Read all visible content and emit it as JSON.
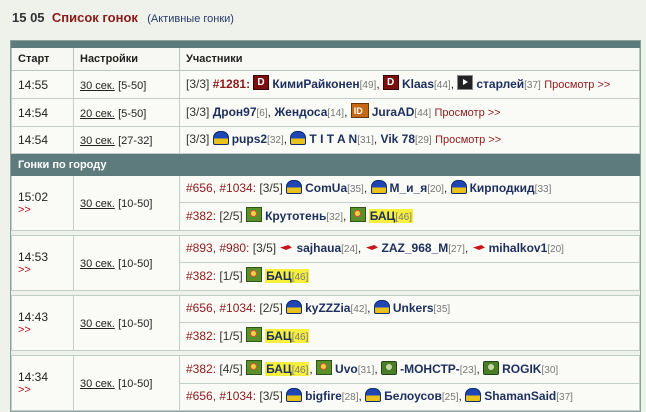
{
  "header": {
    "time": "15 05",
    "title": "Список гонок",
    "subtitle": "(Активные гонки)"
  },
  "columns": {
    "start": "Старт",
    "settings": "Настройки",
    "players": "Участники"
  },
  "view_label": "Просмотр >>",
  "arrow_label": ">>",
  "section_title": "Гонки по городу",
  "races": [
    {
      "time": "14:55",
      "duration": "30 сек.",
      "range": "[5-50]",
      "count": "[3/3]",
      "id": "#1281:",
      "players": [
        {
          "name": "КимиРайконен",
          "lvl": "[49]",
          "icon": "dark-icon"
        },
        {
          "name": "Klaas",
          "lvl": "[44]",
          "icon": "dark-icon"
        },
        {
          "name": "старлей",
          "lvl": "[37]",
          "icon": "veteran-icon"
        }
      ]
    },
    {
      "time": "14:54",
      "duration": "20 сек.",
      "range": "[5-50]",
      "count": "[3/3]",
      "players": [
        {
          "name": "Дрон97",
          "lvl": "[6]"
        },
        {
          "name": "Жендоса",
          "lvl": "[14]"
        },
        {
          "name": "JuraAD",
          "lvl": "[44]",
          "icon": "id-icon"
        }
      ]
    },
    {
      "time": "14:54",
      "duration": "30 сек.",
      "range": "[27-32]",
      "count": "[3/3]",
      "players": [
        {
          "name": "pups2",
          "lvl": "[32]",
          "icon": "helmet-icon"
        },
        {
          "name": "T I T A N",
          "lvl": "[31]",
          "icon": "helmet-icon"
        },
        {
          "name": "Vik 78",
          "lvl": "[29]"
        }
      ]
    }
  ],
  "city_races": [
    {
      "time": "15:02",
      "duration": "30 сек.",
      "range": "[10-50]",
      "lines": [
        {
          "ids": "#656, #1034:",
          "count": "[3/5]",
          "players": [
            {
              "name": "ComUa",
              "lvl": "[35]",
              "icon": "helmet-icon"
            },
            {
              "name": "М_и_я",
              "lvl": "[20]",
              "icon": "helmet-icon"
            },
            {
              "name": "Кирподкид",
              "lvl": "[33]",
              "icon": "helmet-icon"
            }
          ]
        },
        {
          "ids": "#382:",
          "count": "[2/5]",
          "players": [
            {
              "name": "Крутотень",
              "lvl": "[32]",
              "icon": "flower-icon"
            },
            {
              "name": "БАЦ",
              "lvl": "[46]",
              "icon": "flower-icon",
              "hl": true
            }
          ]
        }
      ]
    },
    {
      "time": "14:53",
      "duration": "30 сек.",
      "range": "[10-50]",
      "lines": [
        {
          "ids": "#893, #980:",
          "count": "[3/5]",
          "players": [
            {
              "name": "sajhaua",
              "lvl": "[24]",
              "icon": "bird-icon"
            },
            {
              "name": "ZAZ_968_M",
              "lvl": "[27]",
              "icon": "bird-icon"
            },
            {
              "name": "mihalkov1",
              "lvl": "[20]",
              "icon": "bird-icon"
            }
          ]
        },
        {
          "ids": "#382:",
          "count": "[1/5]",
          "players": [
            {
              "name": "БАЦ",
              "lvl": "[46]",
              "icon": "flower-icon",
              "hl": true
            }
          ]
        }
      ]
    },
    {
      "time": "14:43",
      "duration": "30 сек.",
      "range": "[10-50]",
      "lines": [
        {
          "ids": "#656, #1034:",
          "count": "[2/5]",
          "players": [
            {
              "name": "kyZZZia",
              "lvl": "[42]",
              "icon": "helmet-icon"
            },
            {
              "name": "Unkers",
              "lvl": "[35]",
              "icon": "helmet-icon"
            }
          ]
        },
        {
          "ids": "#382:",
          "count": "[1/5]",
          "players": [
            {
              "name": "БАЦ",
              "lvl": "[46]",
              "icon": "flower-icon",
              "hl": true
            }
          ]
        }
      ]
    },
    {
      "time": "14:34",
      "duration": "30 сек.",
      "range": "[10-50]",
      "lines": [
        {
          "ids": "#382:",
          "count": "[4/5]",
          "players": [
            {
              "name": "БАЦ",
              "lvl": "[46]",
              "icon": "flower-icon",
              "hl": true
            },
            {
              "name": "Uvo",
              "lvl": "[31]",
              "icon": "flower-icon"
            },
            {
              "name": "-МОНСТР-",
              "lvl": "[23]",
              "icon": "face-icon"
            },
            {
              "name": "ROGIK",
              "lvl": "[30]",
              "icon": "face-icon"
            }
          ]
        },
        {
          "ids": "#656, #1034:",
          "count": "[3/5]",
          "players": [
            {
              "name": "bigfire",
              "lvl": "[28]",
              "icon": "helmet-icon"
            },
            {
              "name": "Белоусов",
              "lvl": "[25]",
              "icon": "helmet-icon"
            },
            {
              "name": "ShamanSaid",
              "lvl": "[37]",
              "icon": "helmet-icon"
            }
          ]
        }
      ]
    }
  ]
}
